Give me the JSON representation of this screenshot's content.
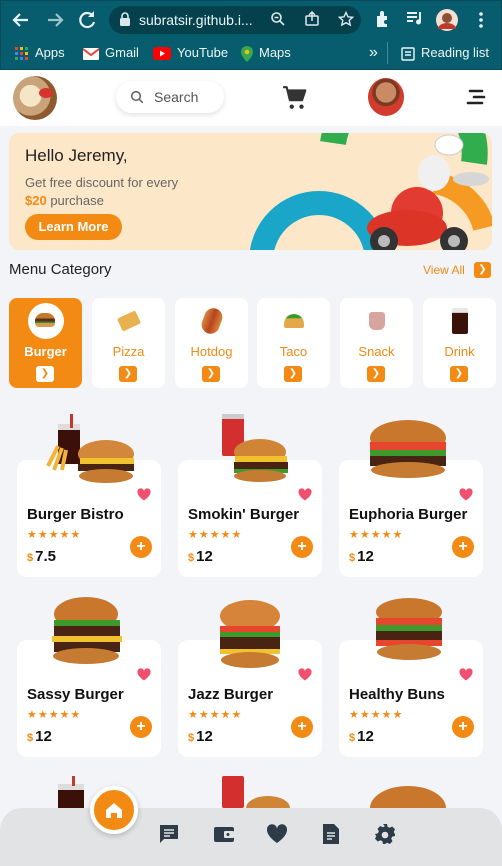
{
  "browser": {
    "url": "subratsir.github.i...",
    "bookmarks": [
      {
        "label": "Apps",
        "icon": "apps-grid-icon"
      },
      {
        "label": "Gmail",
        "icon": "gmail-icon"
      },
      {
        "label": "YouTube",
        "icon": "youtube-icon"
      },
      {
        "label": "Maps",
        "icon": "maps-icon"
      }
    ],
    "overflow_label": "»",
    "reading_list_label": "Reading list"
  },
  "header": {
    "search_placeholder": "Search"
  },
  "banner": {
    "greeting": "Hello Jeremy,",
    "line1": "Get free discount for every",
    "amount": "$20",
    "line2_suffix": " purchase",
    "button_label": "Learn More"
  },
  "menu_category": {
    "title": "Menu Category",
    "view_all_label": "View All",
    "items": [
      {
        "label": "Burger",
        "active": true
      },
      {
        "label": "Pizza",
        "active": false
      },
      {
        "label": "Hotdog",
        "active": false
      },
      {
        "label": "Taco",
        "active": false
      },
      {
        "label": "Snack",
        "active": false
      },
      {
        "label": "Drink",
        "active": false
      }
    ]
  },
  "currency_symbol": "$",
  "rating_stars": "★★★★★",
  "add_label": "+",
  "foods": [
    {
      "name": "Burger Bistro",
      "price": "7.5",
      "rating": 5
    },
    {
      "name": "Smokin' Burger",
      "price": "12",
      "rating": 5
    },
    {
      "name": "Euphoria Burger",
      "price": "12",
      "rating": 5
    },
    {
      "name": "Sassy Burger",
      "price": "12",
      "rating": 5
    },
    {
      "name": "Jazz Burger",
      "price": "12",
      "rating": 5
    },
    {
      "name": "Healthy Buns",
      "price": "12",
      "rating": 5
    }
  ],
  "colors": {
    "accent": "#f28a14",
    "browser_frame": "#075d6e",
    "banner_bg": "#fde7c9",
    "heart": "#f0506e"
  },
  "bottom_nav": {
    "icons": [
      "home-icon",
      "chat-icon",
      "wallet-icon",
      "heart-icon",
      "notes-icon",
      "settings-icon"
    ]
  }
}
